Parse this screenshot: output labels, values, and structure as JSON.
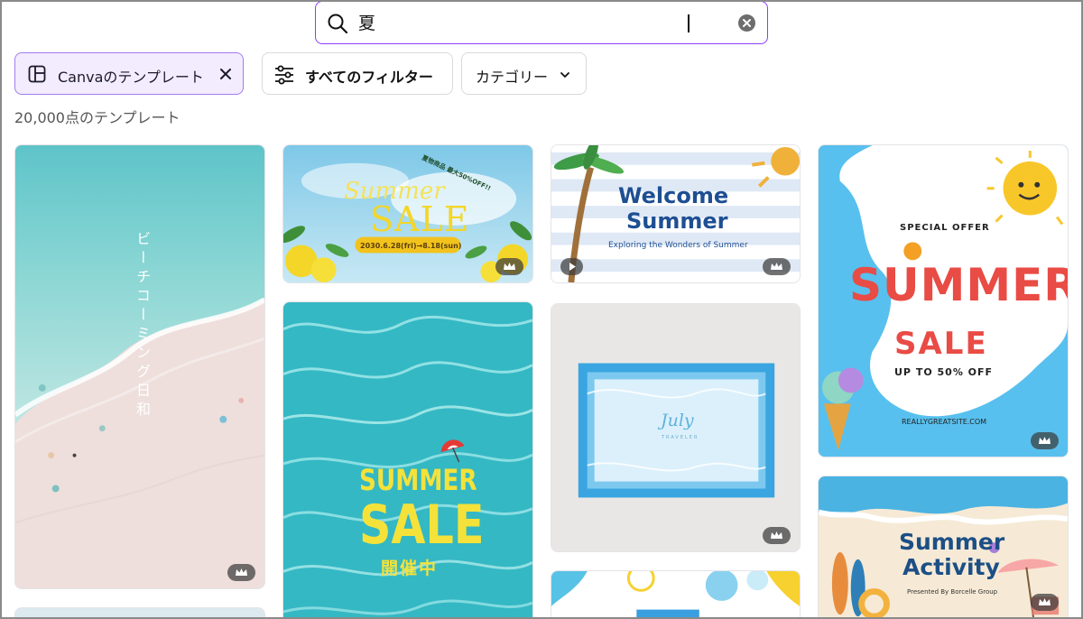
{
  "search": {
    "query": "夏"
  },
  "filters": {
    "canva_chip_label": "Canvaのテンプレート",
    "all_filters_label": "すべてのフィルター",
    "category_label": "カテゴリー"
  },
  "results_count": "20,000点のテンプレート",
  "cards": {
    "beach": {
      "vertical_text": "ビーチコーミング日和"
    },
    "summer_sale_1": {
      "script": "Summer",
      "title": "SALE",
      "badge": "夏物商品 最大50%OFF!!",
      "dates": "2030.6.28(fri)→8.18(sun)"
    },
    "welcome": {
      "line1": "Welcome",
      "line2": "Summer",
      "subtitle": "Exploring the Wonders of Summer"
    },
    "special": {
      "kicker": "SPECIAL OFFER",
      "word": "SUMMER",
      "sale": "SALE",
      "upto": "UP TO 50% OFF",
      "site": "REALLYGREATSITE.COM"
    },
    "pool": {
      "line1": "SUMMER",
      "line2": "SALE",
      "line3": "開催中"
    },
    "july": {
      "title": "July",
      "sub": "TRAVELER"
    },
    "activity": {
      "line1": "Summer",
      "line2": "Activity",
      "presented": "Presented By Borcelle Group"
    }
  },
  "colors": {
    "accent": "#8b3dff",
    "chip_bg": "#f3ecff",
    "sale_yellow": "#f4e23a",
    "welcome_blue": "#1e4f93"
  }
}
